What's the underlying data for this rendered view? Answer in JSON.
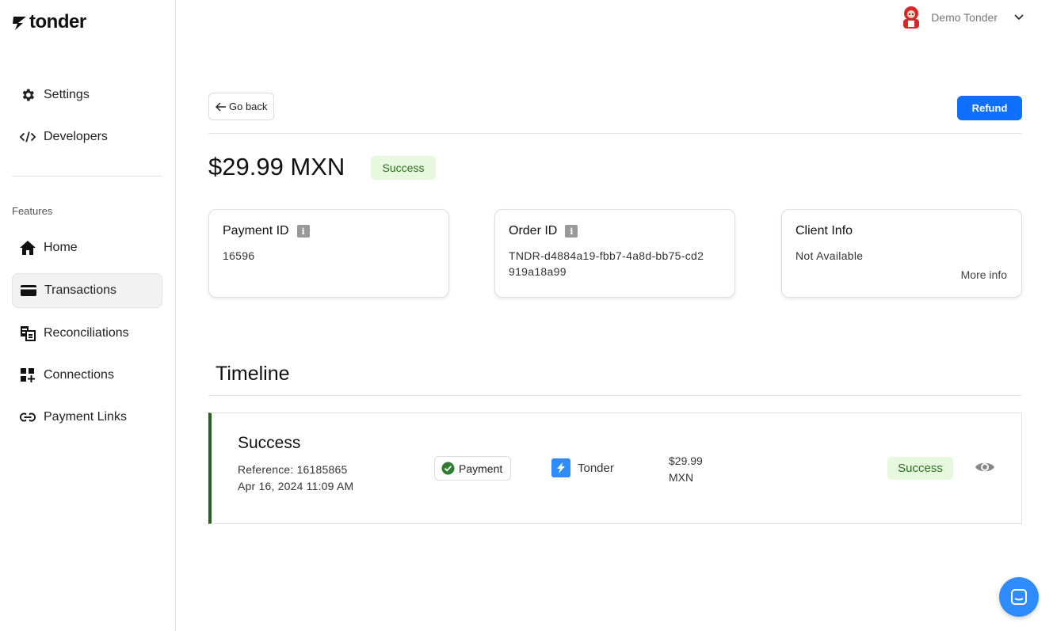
{
  "brand": {
    "name": "tonder"
  },
  "sidebar": {
    "top_items": [
      {
        "label": "Settings",
        "icon": "gear-icon"
      },
      {
        "label": "Developers",
        "icon": "code-icon"
      }
    ],
    "section_label": "Features",
    "items": [
      {
        "label": "Home",
        "icon": "home-icon"
      },
      {
        "label": "Transactions",
        "icon": "card-icon",
        "active": true
      },
      {
        "label": "Reconciliations",
        "icon": "reconcile-icon"
      },
      {
        "label": "Connections",
        "icon": "widgets-icon"
      },
      {
        "label": "Payment Links",
        "icon": "link-icon"
      }
    ]
  },
  "header": {
    "user_name": "Demo Tonder"
  },
  "main": {
    "back_label": "Go back",
    "refund_label": "Refund",
    "amount": "$29.99 MXN",
    "status": "Success",
    "cards": {
      "payment": {
        "title": "Payment ID",
        "value": "16596"
      },
      "order": {
        "title": "Order ID",
        "value": "TNDR-d4884a19-fbb7-4a8d-bb75-cd2919a18a99"
      },
      "client": {
        "title": "Client Info",
        "value": "Not Available",
        "more": "More info"
      }
    },
    "timeline": {
      "title": "Timeline",
      "events": [
        {
          "status": "Success",
          "reference": "Reference: 16185865",
          "date": "Apr 16, 2024 11:09 AM",
          "type": "Payment",
          "provider": "Tonder",
          "amount_value": "$29.99",
          "amount_currency": "MXN",
          "badge": "Success"
        }
      ]
    }
  },
  "colors": {
    "accent": "#0f6fff",
    "success_bg": "#e6f9df",
    "success_text": "#2e6b1f",
    "timeline_bar": "#2d5e1f",
    "chat_button": "#2f8cff"
  }
}
